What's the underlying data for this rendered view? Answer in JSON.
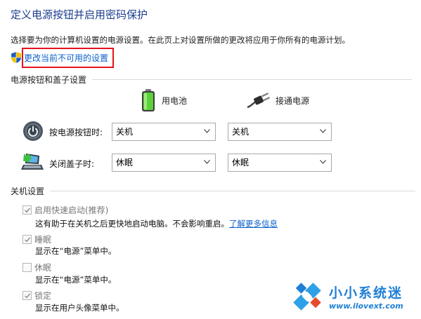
{
  "page": {
    "title": "定义电源按钮并启用密码保护",
    "intro": "选择要为你的计算机设置的电源设置。在此页上对设置所做的更改将应用于你所有的电源计划。",
    "change_link": "更改当前不可用的设置"
  },
  "power_buttons_section": {
    "title": "电源按钮和盖子设置",
    "columns": {
      "battery": "用电池",
      "plugged_in": "接通电源"
    },
    "rows": [
      {
        "label": "按电源按钮时:",
        "battery_value": "关机",
        "plugged_value": "关机",
        "icon": "power-button-icon"
      },
      {
        "label": "关闭盖子时:",
        "battery_value": "休眠",
        "plugged_value": "休眠",
        "icon": "laptop-lid-icon"
      }
    ]
  },
  "shutdown_section": {
    "title": "关机设置",
    "options": [
      {
        "label": "启用快速启动(推荐)",
        "checked": true,
        "desc": "这有助于在关机之后更快地启动电脑。不会影响重启。",
        "link": "了解更多信息"
      },
      {
        "label": "睡眠",
        "checked": true,
        "desc": "显示在“电源”菜单中。"
      },
      {
        "label": "休眠",
        "checked": false,
        "desc": "显示在“电源”菜单中。"
      },
      {
        "label": "锁定",
        "checked": true,
        "desc": "显示在用户头像菜单中。"
      }
    ]
  },
  "watermark": {
    "title": "小小系统迷",
    "url": "www.ilovext.com"
  },
  "colors": {
    "title": "#1c3e8f",
    "link": "#0b5fcc",
    "highlight": "#e1131c",
    "watermark": "#1e7fd6"
  }
}
